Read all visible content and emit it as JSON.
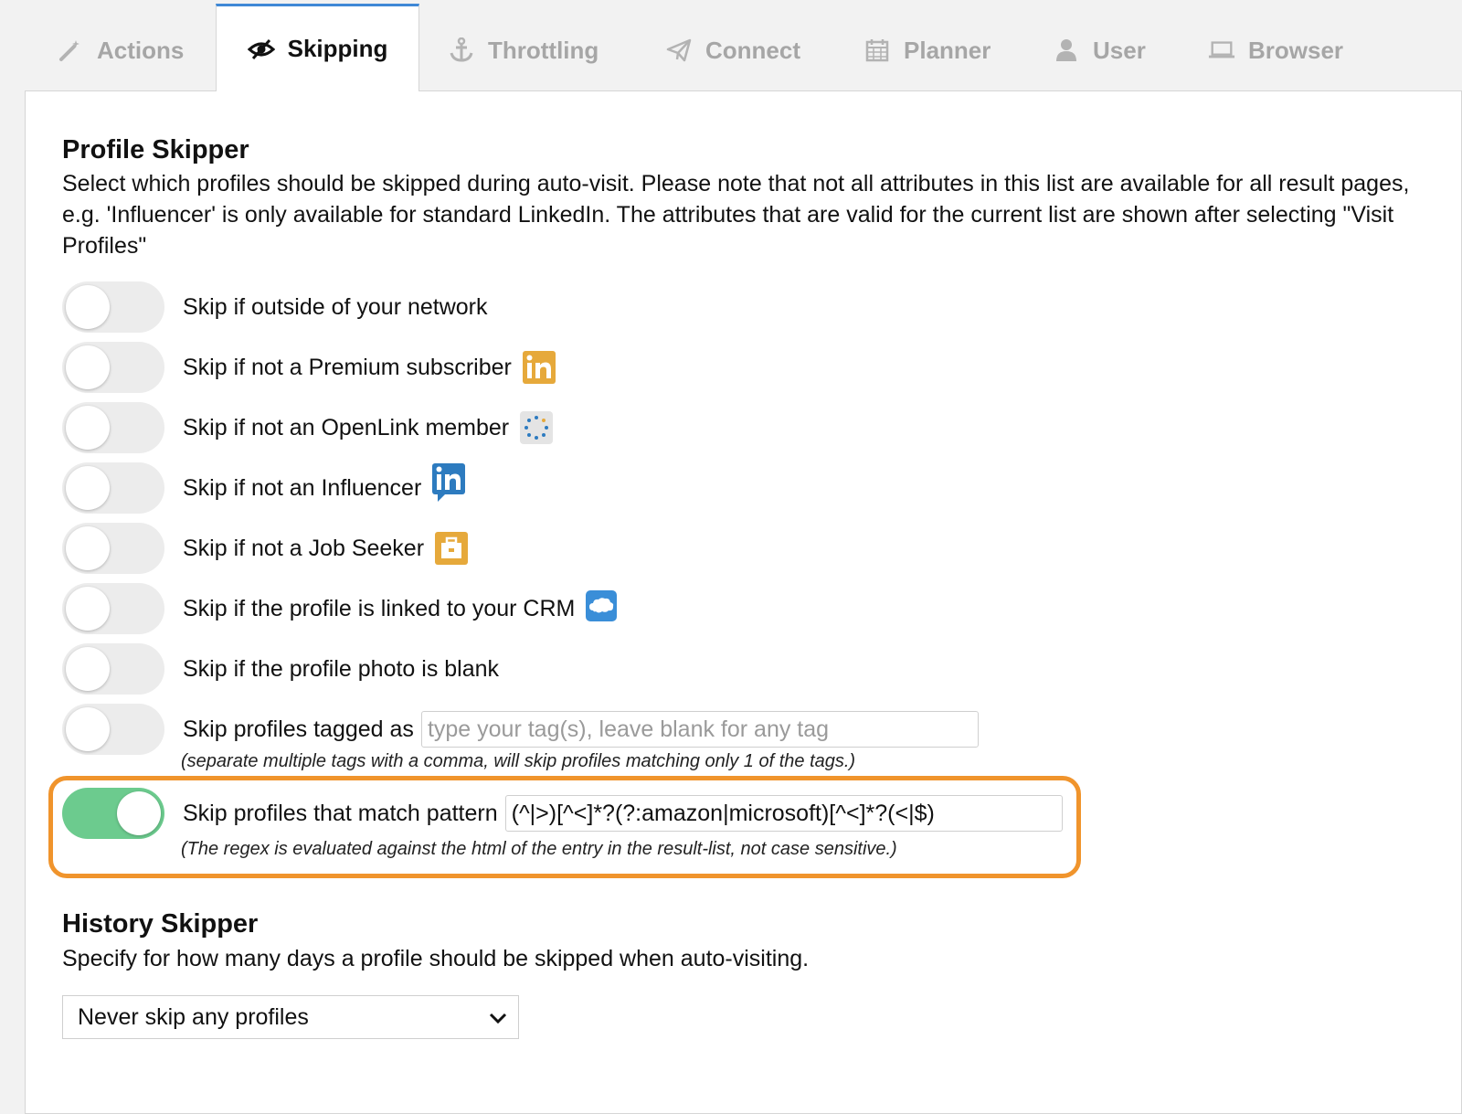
{
  "tabs": [
    {
      "label": "Actions",
      "icon": "magic-wand-icon"
    },
    {
      "label": "Skipping",
      "icon": "eye-slash-icon",
      "active": true
    },
    {
      "label": "Throttling",
      "icon": "anchor-icon"
    },
    {
      "label": "Connect",
      "icon": "paper-plane-icon"
    },
    {
      "label": "Planner",
      "icon": "calendar-icon"
    },
    {
      "label": "User",
      "icon": "user-icon"
    },
    {
      "label": "Browser",
      "icon": "laptop-icon"
    }
  ],
  "profile_skipper": {
    "title": "Profile Skipper",
    "description": "Select which profiles should be skipped during auto-visit. Please note that not all attributes in this list are available for all result pages, e.g. 'Influencer' is only available for standard LinkedIn. The attributes that are valid for the current list are shown after selecting \"Visit Profiles\"",
    "options": [
      {
        "label": "Skip if outside of your network",
        "enabled": false
      },
      {
        "label": "Skip if not a Premium subscriber",
        "enabled": false,
        "icon": "linkedin-premium-icon"
      },
      {
        "label": "Skip if not an OpenLink member",
        "enabled": false,
        "icon": "openlink-icon"
      },
      {
        "label": "Skip if not an Influencer",
        "enabled": false,
        "icon": "linkedin-influencer-icon"
      },
      {
        "label": "Skip if not a Job Seeker",
        "enabled": false,
        "icon": "job-seeker-icon"
      },
      {
        "label": "Skip if the profile is linked to your CRM",
        "enabled": false,
        "icon": "crm-icon"
      },
      {
        "label": "Skip if the profile photo is blank",
        "enabled": false
      }
    ],
    "tagged": {
      "label": "Skip profiles tagged as",
      "enabled": false,
      "placeholder": "type your tag(s), leave blank for any tag",
      "value": "",
      "hint": "(separate multiple tags with a comma, will skip profiles matching only 1 of the tags.)"
    },
    "pattern": {
      "label": "Skip profiles that match pattern",
      "enabled": true,
      "value": "(^|>)[^<]*?(?:amazon|microsoft)[^<]*?(<|$)",
      "hint": "(The regex is evaluated against the html of the entry in the result-list, not case sensitive.)"
    }
  },
  "history_skipper": {
    "title": "History Skipper",
    "description": "Specify for how many days a profile should be skipped when auto-visiting.",
    "selected": "Never skip any profiles"
  },
  "colors": {
    "accent": "#3f88d6",
    "toggle_on": "#6ccb8e",
    "highlight": "#f0942c",
    "premium": "#e6a93b",
    "linkedin_blue": "#2d7bbf"
  }
}
